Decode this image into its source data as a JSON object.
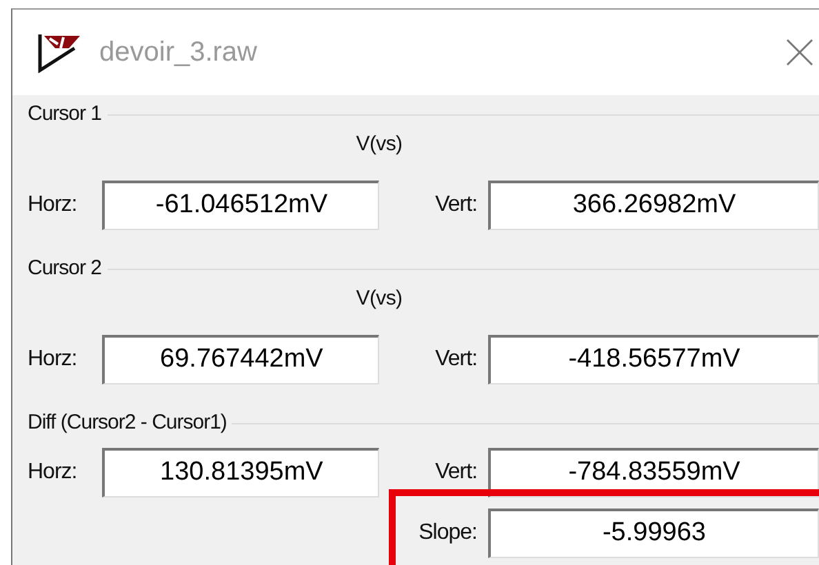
{
  "window": {
    "title": "devoir_3.raw"
  },
  "groups": [
    {
      "title": "Cursor 1",
      "trace": "V(vs)",
      "fields": [
        {
          "label": "Horz:",
          "value": "-61.046512mV"
        },
        {
          "label": "Vert:",
          "value": "366.26982mV"
        }
      ]
    },
    {
      "title": "Cursor 2",
      "trace": "V(vs)",
      "fields": [
        {
          "label": "Horz:",
          "value": "69.767442mV"
        },
        {
          "label": "Vert:",
          "value": "-418.56577mV"
        }
      ]
    },
    {
      "title": "Diff (Cursor2 - Cursor1)",
      "fields": [
        {
          "label": "Horz:",
          "value": "130.81395mV"
        },
        {
          "label": "Vert:",
          "value": "-784.83559mV"
        }
      ],
      "slope": {
        "label": "Slope:",
        "value": "-5.99963",
        "highlighted": true
      }
    }
  ]
}
